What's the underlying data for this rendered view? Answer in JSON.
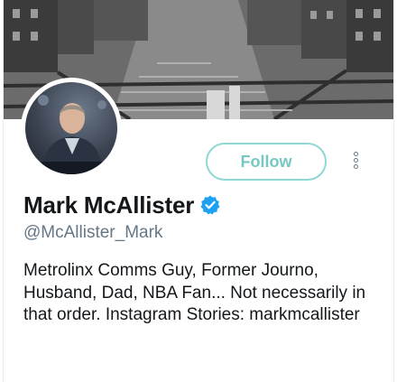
{
  "profile": {
    "name": "Mark McAllister",
    "handle": "@McAllister_Mark",
    "bio": "Metrolinx Comms Guy, Former Journo, Husband, Dad, NBA Fan... Not necessarily in that order. Instagram Stories: markmcallister",
    "verified": true
  },
  "actions": {
    "follow_label": "Follow",
    "more_icon": "more-vertical-icon"
  },
  "colors": {
    "follow_border": "#8fd8d3",
    "follow_text": "#77c8c1",
    "verified_badge": "#1da1f2",
    "handle_text": "#657786"
  }
}
